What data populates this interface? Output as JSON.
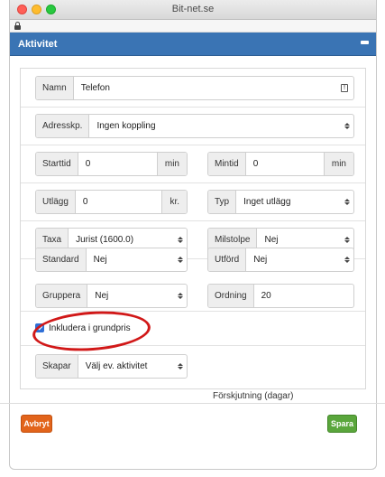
{
  "browser": {
    "title": "Bit-net.se"
  },
  "dialog": {
    "title": "Aktivitet"
  },
  "form": {
    "namn": {
      "label": "Namn",
      "value": "Telefon"
    },
    "adresskp": {
      "label": "Adresskp.",
      "value": "Ingen koppling"
    },
    "starttid": {
      "label": "Starttid",
      "value": "0",
      "unit": "min"
    },
    "mintid": {
      "label": "Mintid",
      "value": "0",
      "unit": "min"
    },
    "utlagg": {
      "label": "Utlägg",
      "value": "0",
      "unit": "kr."
    },
    "typ": {
      "label": "Typ",
      "value": "Inget utlägg"
    },
    "taxa": {
      "label": "Taxa",
      "value": "Jurist (1600.0)"
    },
    "milstolpe": {
      "label": "Milstolpe",
      "value": "Nej"
    },
    "standard": {
      "label": "Standard",
      "value": "Nej"
    },
    "utford": {
      "label": "Utförd",
      "value": "Nej"
    },
    "gruppera": {
      "label": "Gruppera",
      "value": "Nej"
    },
    "ordning": {
      "label": "Ordning",
      "value": "20"
    },
    "inkludera": {
      "label": "Inkludera i grundpris",
      "checked": true
    },
    "skapar": {
      "label": "Skapar",
      "value": "Välj ev. aktivitet"
    },
    "forskjutning": {
      "label": "Förskjutning (dagar)"
    }
  },
  "buttons": {
    "cancel": "Avbryt",
    "save": "Spara"
  },
  "colors": {
    "header": "#3a74b4",
    "cancel": "#e2641b",
    "save": "#5aa63c",
    "annotation": "#d11818",
    "checkbox": "#2f6fd6"
  }
}
